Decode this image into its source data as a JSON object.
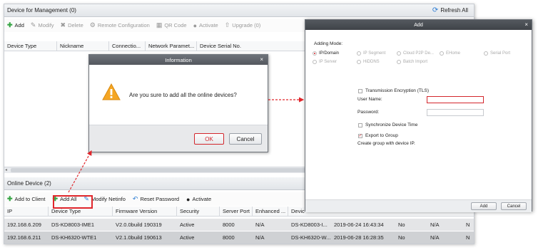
{
  "device_mgmt": {
    "header": "Device for Management (0)",
    "refresh": "Refresh All",
    "toolbar": {
      "add": "Add",
      "modify": "Modify",
      "delete": "Delete",
      "remote_config": "Remote Configuration",
      "qr_code": "QR Code",
      "activate": "Activate",
      "upgrade": "Upgrade (0)"
    },
    "columns": [
      "Device Type",
      "Nickname",
      "Connectio...",
      "Network Paramet...",
      "Device Serial No."
    ]
  },
  "online": {
    "header": "Online Device (2)",
    "toolbar": {
      "add_to_client": "Add to Client",
      "add_all": "Add All",
      "modify_netinfo": "Modify Netinfo",
      "reset_password": "Reset Password",
      "activate": "Activate"
    },
    "columns": [
      "IP",
      "Device Type",
      "Firmware Version",
      "Security",
      "Server Port",
      "Enhanced ...",
      "Devic"
    ],
    "rows": [
      {
        "ip": "192.168.6.209",
        "type": "DS-KD8003-IME1",
        "firmware": "V2.0.0build 190319",
        "security": "Active",
        "port": "8000",
        "enhanced": "N/A",
        "serial": "DS-KD8003-I...",
        "time": "2019-06-24 16:43:34",
        "c1": "No",
        "c2": "N/A",
        "c3": "N"
      },
      {
        "ip": "192.168.6.211",
        "type": "DS-KH6320-WTE1",
        "firmware": "V2.1.0build 190613",
        "security": "Active",
        "port": "8000",
        "enhanced": "N/A",
        "serial": "DS-KH6320-W...",
        "time": "2019-06-28 16:28:35",
        "c1": "No",
        "c2": "N/A",
        "c3": "N"
      }
    ]
  },
  "info_dialog": {
    "title": "Information",
    "message": "Are you sure to add all the online devices?",
    "ok": "OK",
    "cancel": "Cancel"
  },
  "add_dialog": {
    "title": "Add",
    "adding_mode_label": "Adding Mode:",
    "modes": [
      "IP/Domain",
      "IP Segment",
      "Cloud P2P De...",
      "EHome",
      "Serial Port",
      "IP Server",
      "HiDDNS",
      "Batch Import"
    ],
    "tls": "Transmission Encryption (TLS)",
    "username_label": "User Name:",
    "password_label": "Password:",
    "sync_time": "Synchronize Device Time",
    "export_group": "Export to Group",
    "group_hint": "Create group with device IP.",
    "add": "Add",
    "cancel": "Cancel"
  },
  "colors": {
    "accent_red": "#d3262c",
    "highlight_box": "#e0262b",
    "green": "#36a544",
    "blue": "#2a7bd3"
  },
  "icons": [
    "refresh-icon",
    "plus-icon",
    "edit-icon",
    "delete-icon",
    "gear-icon",
    "qr-icon",
    "activate-icon",
    "upgrade-icon",
    "warning-icon",
    "close-icon",
    "reset-icon"
  ]
}
